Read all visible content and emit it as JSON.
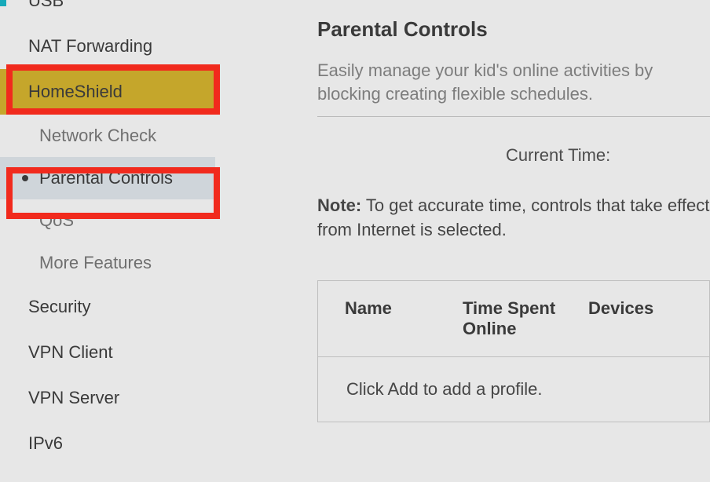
{
  "sidebar": {
    "items": [
      {
        "label": "USB",
        "type": "main"
      },
      {
        "label": "NAT Forwarding",
        "type": "main"
      },
      {
        "label": "HomeShield",
        "type": "main",
        "highlighted": true
      },
      {
        "label": "Network Check",
        "type": "sub"
      },
      {
        "label": "Parental Controls",
        "type": "sub",
        "active": true
      },
      {
        "label": "QoS",
        "type": "sub"
      },
      {
        "label": "More Features",
        "type": "sub"
      },
      {
        "label": "Security",
        "type": "main"
      },
      {
        "label": "VPN Client",
        "type": "main"
      },
      {
        "label": "VPN Server",
        "type": "main"
      },
      {
        "label": "IPv6",
        "type": "main"
      }
    ]
  },
  "content": {
    "title": "Parental Controls",
    "description": "Easily manage your kid's online activities by blocking creating flexible schedules.",
    "current_time_label": "Current Time:",
    "current_time_value": "",
    "note_prefix": "Note:",
    "note_text": " To get accurate time, controls that take effect from Internet is selected.",
    "table": {
      "headers": {
        "name": "Name",
        "time": "Time Spent Online",
        "devices": "Devices"
      },
      "empty_text": "Click Add to add a profile."
    }
  }
}
